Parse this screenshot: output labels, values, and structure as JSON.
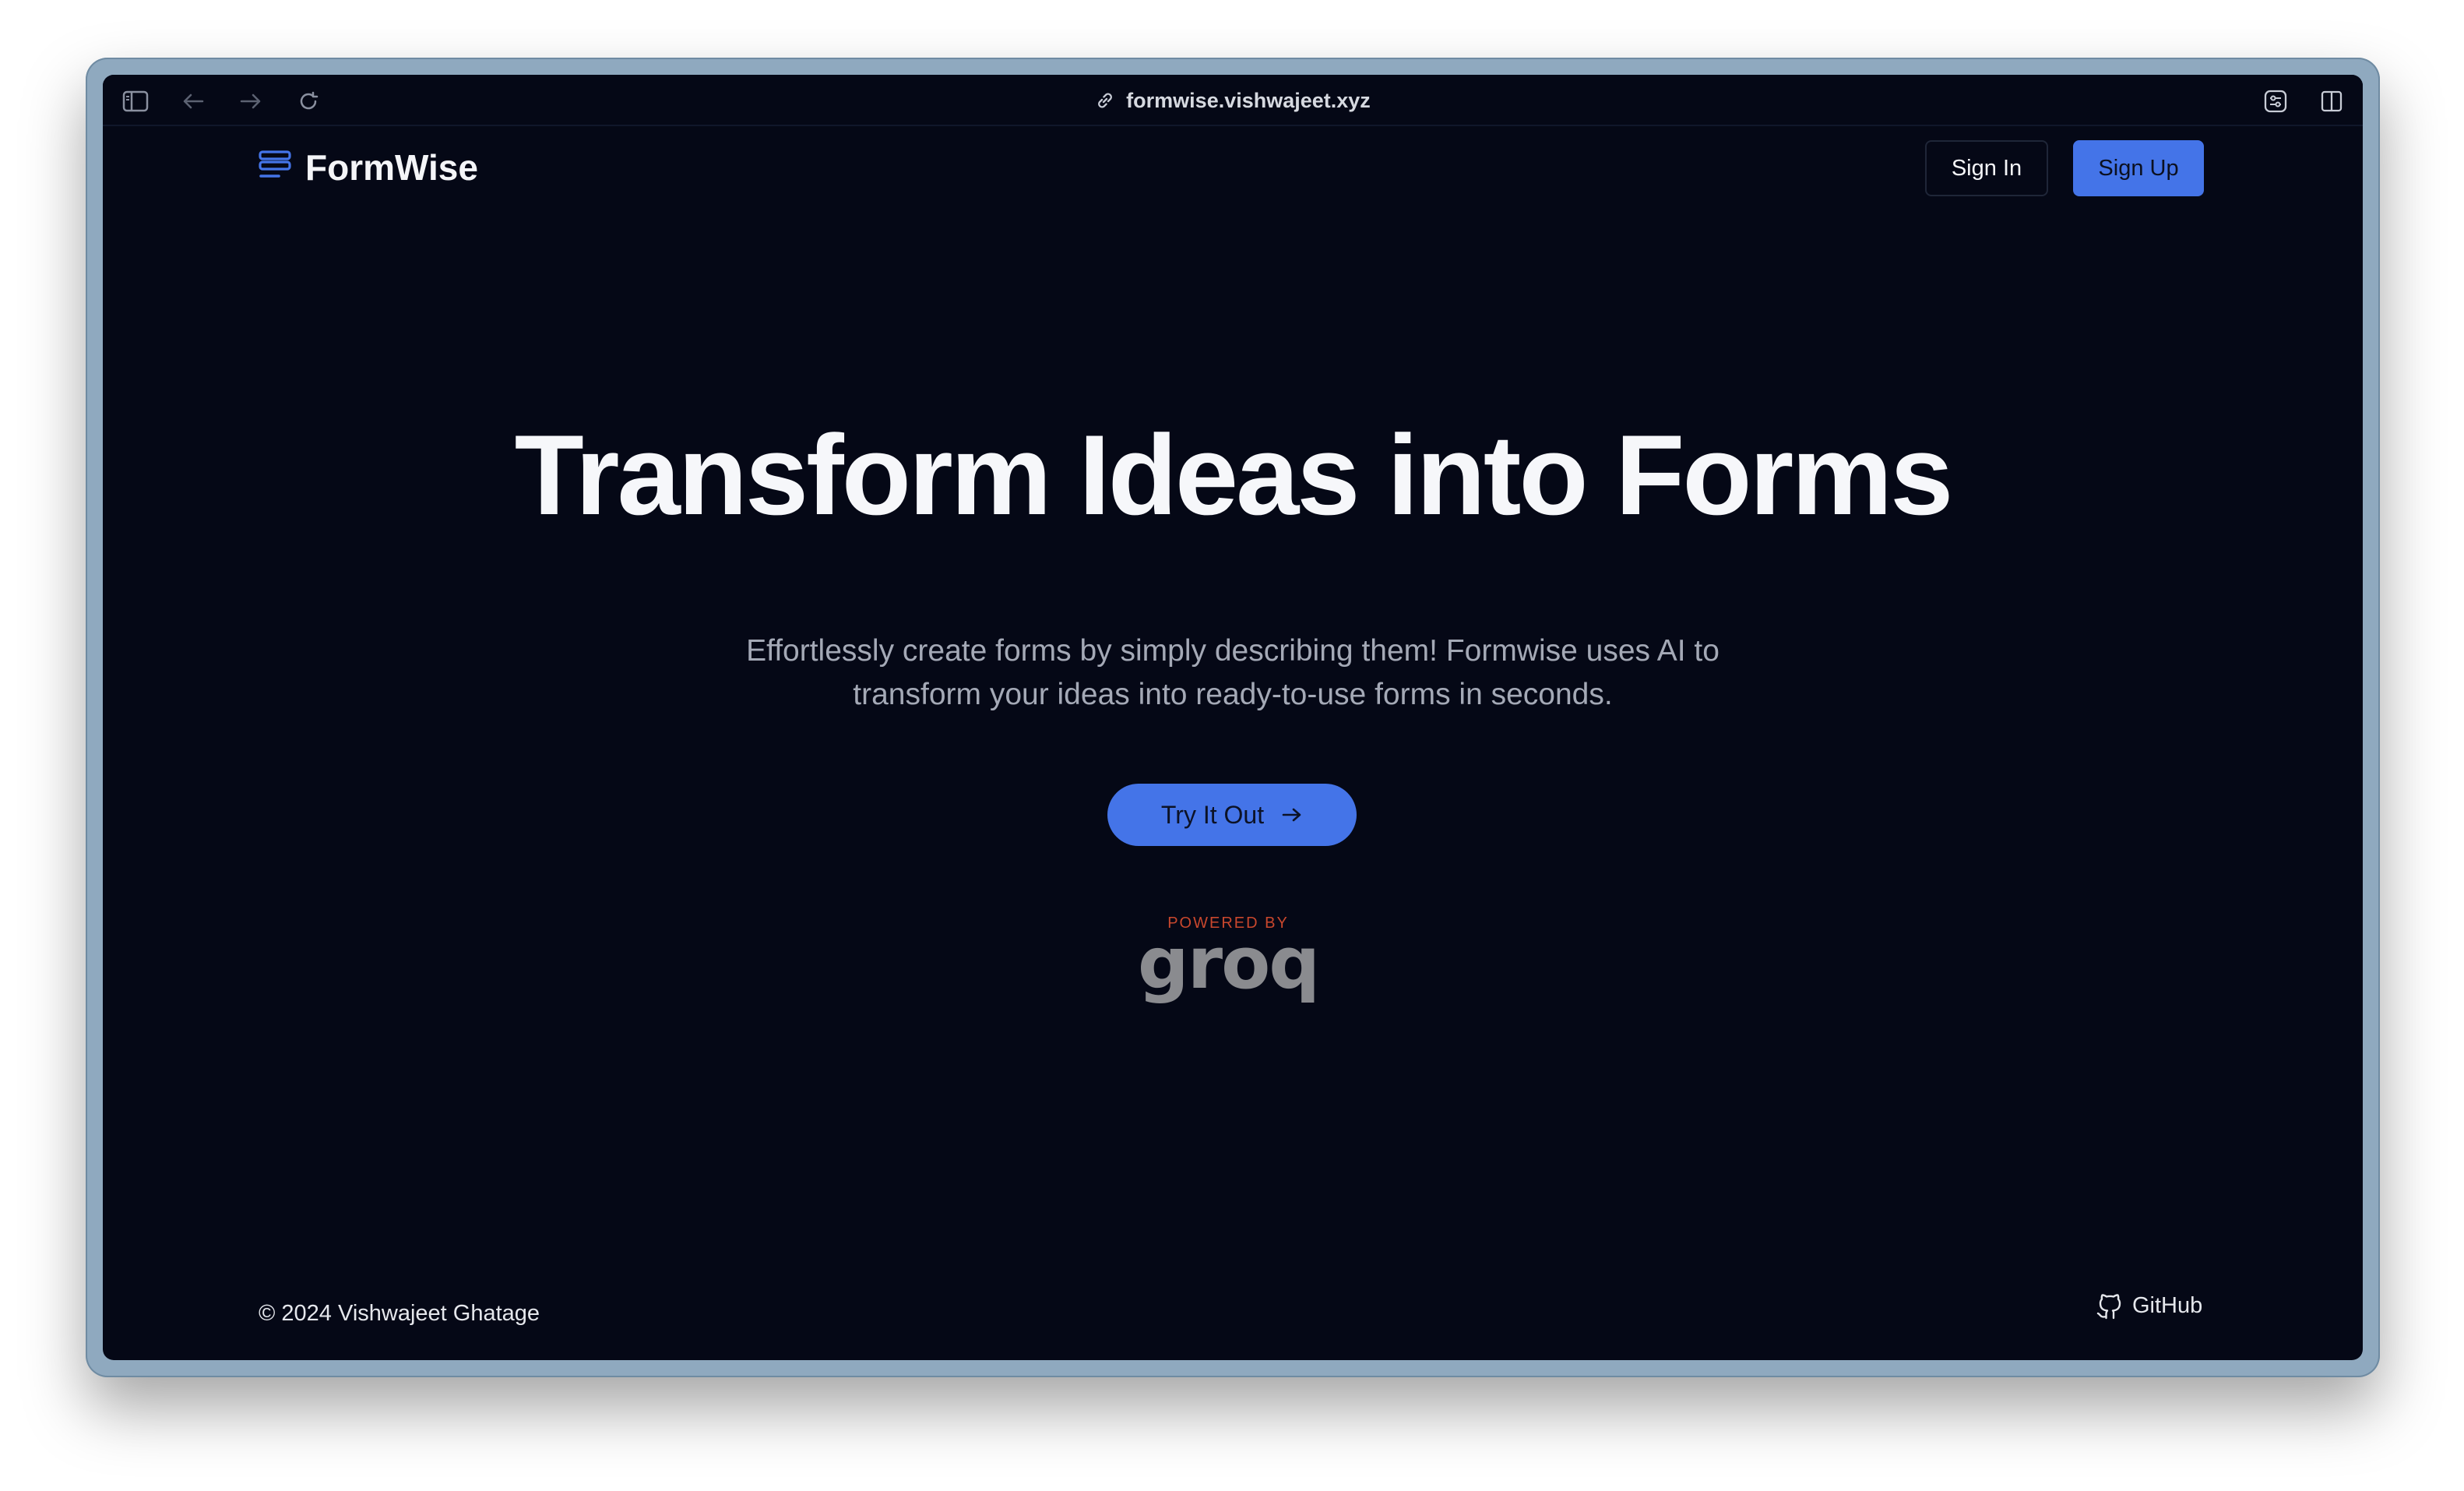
{
  "browser": {
    "url": "formwise.vishwajeet.xyz",
    "icons": [
      "sidebar-toggle-icon",
      "back-arrow-icon",
      "forward-arrow-icon",
      "reload-icon",
      "link-icon",
      "extension-icon",
      "split-view-icon"
    ]
  },
  "nav": {
    "brand": "FormWise",
    "sign_in": "Sign In",
    "sign_up": "Sign Up"
  },
  "hero": {
    "title": "Transform Ideas into Forms",
    "subtitle": "Effortlessly create forms by simply describing them! Formwise uses AI to transform your ideas into ready-to-use forms in seconds.",
    "cta": "Try It Out"
  },
  "powered_by": {
    "label": "POWERED BY",
    "brand": "groq"
  },
  "footer": {
    "copyright": "© 2024 Vishwajeet Ghatage",
    "github": "GitHub"
  },
  "colors": {
    "background": "#050816",
    "accent": "#4474e8",
    "text": "#f4f5f8",
    "muted": "#a4a9b6",
    "powered_label": "#c9472d"
  }
}
